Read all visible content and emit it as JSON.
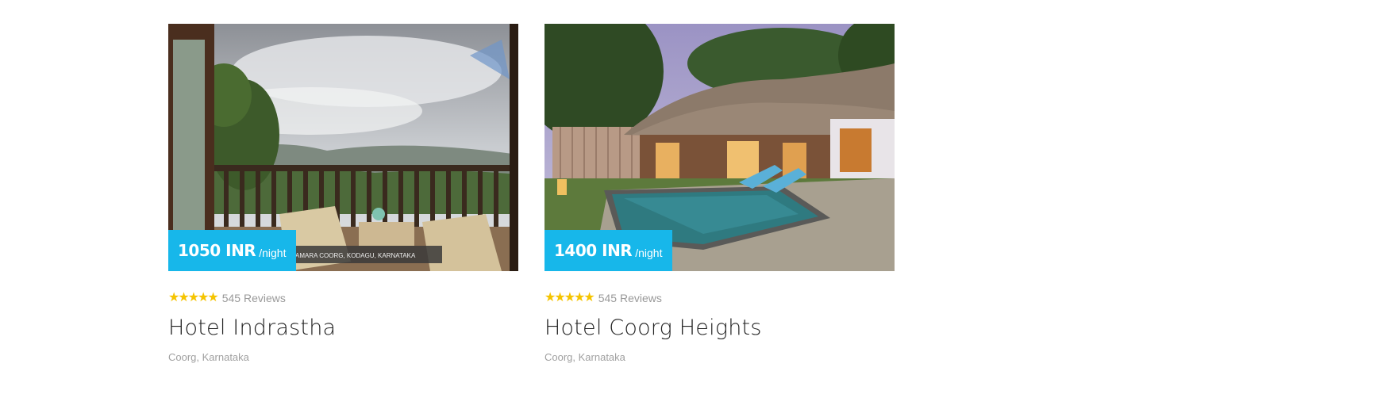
{
  "hotels": [
    {
      "price": "1050 INR",
      "per_night": "/night",
      "stars": [
        "★",
        "★",
        "★",
        "★",
        "★"
      ],
      "reviews": "545 Reviews",
      "name": "Hotel Indrastha",
      "location": "Coorg, Karnataka",
      "photo_caption": "AMARA COORG, KODAGU, KARNATAKA"
    },
    {
      "price": "1400 INR",
      "per_night": "/night",
      "stars": [
        "★",
        "★",
        "★",
        "★",
        "★"
      ],
      "reviews": "545 Reviews",
      "name": "Hotel Coorg Heights",
      "location": "Coorg, Karnataka"
    }
  ],
  "colors": {
    "price_badge": "#17b7ea",
    "star": "#f5c400",
    "muted_text": "#999999",
    "title_text": "#222222"
  }
}
